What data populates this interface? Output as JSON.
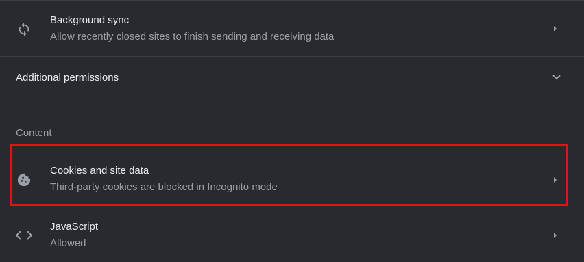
{
  "top_row": {
    "icon": "sync-icon",
    "title": "Background sync",
    "subtitle": "Allow recently closed sites to finish sending and receiving data"
  },
  "additional_permissions": {
    "label": "Additional permissions",
    "icon": "chevron-down-icon",
    "expanded": false
  },
  "content_section": {
    "label": "Content"
  },
  "cookies_row": {
    "icon": "cookie-icon",
    "title": "Cookies and site data",
    "subtitle": "Third-party cookies are blocked in Incognito mode",
    "highlighted": true,
    "highlight_color": "#e01414"
  },
  "javascript_row": {
    "icon": "code-icon",
    "title": "JavaScript",
    "subtitle": "Allowed"
  },
  "colors": {
    "background": "#292a2d",
    "divider": "#3c4043",
    "primary_text": "#e8eaed",
    "secondary_text": "#9aa0a6"
  }
}
